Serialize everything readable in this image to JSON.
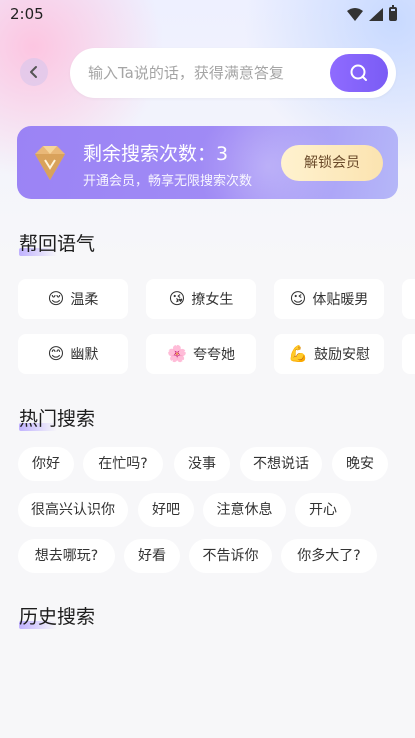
{
  "status_bar": {
    "time": "2:05"
  },
  "search": {
    "placeholder": "输入Ta说的话，获得满意答复"
  },
  "vip": {
    "title": "剩余搜索次数：3",
    "subtitle": "开通会员，畅享无限搜索次数",
    "unlock_label": "解锁会员"
  },
  "tone_section": {
    "title": "帮回语气",
    "items": [
      {
        "emoji": "😌",
        "label": "温柔"
      },
      {
        "emoji": "😘",
        "label": "撩女生"
      },
      {
        "emoji": "😉",
        "label": "体贴暖男"
      },
      {
        "emoji": "😊",
        "label": "幽默"
      },
      {
        "emoji": "🌸",
        "label": "夸夸她"
      },
      {
        "emoji": "💪",
        "label": "鼓励安慰"
      }
    ]
  },
  "hot_section": {
    "title": "热门搜索",
    "items": [
      "你好",
      "在忙吗?",
      "没事",
      "不想说话",
      "晚安",
      "很高兴认识你",
      "好吧",
      "注意休息",
      "开心",
      "想去哪玩?",
      "好看",
      "不告诉你",
      "你多大了?"
    ]
  },
  "history_section": {
    "title": "历史搜索"
  },
  "colors": {
    "accent": "#7a5cf5",
    "vip_card": "#9b83f5",
    "unlock_button": "#fbe3b0"
  }
}
